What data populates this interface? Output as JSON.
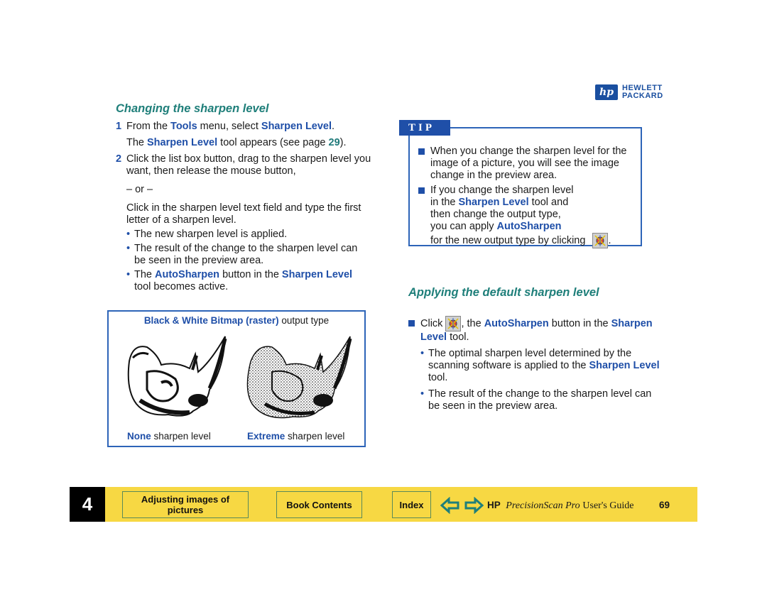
{
  "logo": {
    "mark": "hp",
    "line1": "HEWLETT",
    "line2": "PACKARD"
  },
  "left": {
    "title": "Changing the sharpen level",
    "step1": {
      "num": "1",
      "pre": "From the ",
      "tools": "Tools",
      "mid": " menu, select ",
      "sharpen": "Sharpen Level",
      "post": "."
    },
    "step1_note": {
      "pre": "The ",
      "sharpen": "Sharpen Level",
      "mid": " tool appears (see page ",
      "page": "29",
      "post": ")."
    },
    "step2": {
      "num": "2",
      "text": "Click the list box button, drag to the sharpen level you want, then release the mouse button,"
    },
    "or": "– or –",
    "alt": "Click in the sharpen level text field and type the first letter of a sharpen level.",
    "bullets": [
      "The new sharpen level is applied.",
      "The result of the change to the sharpen level can be seen in the preview area."
    ],
    "bullet3": {
      "pre": "The ",
      "auto": "AutoSharpen",
      "mid": " button in the ",
      "sharpen": "Sharpen Level",
      "post": " tool becomes active."
    }
  },
  "figure": {
    "caption_blue": "Black & White Bitmap (raster)",
    "caption_rest": " output type",
    "left_label_blue": "None",
    "left_label_rest": " sharpen level",
    "right_label_blue": "Extreme",
    "right_label_rest": " sharpen level"
  },
  "tip": {
    "tab": "TIP",
    "item1": "When you change the sharpen level for the image of a picture, you will see the image change in the preview area.",
    "item2": {
      "l1": "If you change the sharpen level",
      "l2pre": "in the ",
      "l2blue": "Sharpen Level",
      "l2post": " tool and",
      "l3": "then change the output type,",
      "l4pre": "you can apply ",
      "l4blue": "AutoSharpen",
      "l5": "for the new output type by clicking ",
      "l5post": "."
    }
  },
  "right": {
    "title": "Applying the default sharpen level",
    "item": {
      "pre": "Click ",
      "mid": ", the ",
      "auto": "AutoSharpen",
      "mid2": " button in the ",
      "sharpen": "Sharpen Level",
      "post": " tool."
    },
    "bullet1": {
      "pre": "The optimal sharpen level determined by the scanning software is applied to the ",
      "sharpen": "Sharpen Level",
      "post": " tool."
    },
    "bullet2": "The result of the change to the sharpen level can be seen in the preview area."
  },
  "footer": {
    "chapter": "4",
    "chapter_link": "Adjusting images of pictures",
    "book_contents": "Book Contents",
    "index": "Index",
    "hp": "HP",
    "product": "PrecisionScan Pro",
    "guide": "User's Guide",
    "page": "69",
    "colors": {
      "bar": "#f7d843",
      "arrow": "#1f7f7a"
    }
  }
}
